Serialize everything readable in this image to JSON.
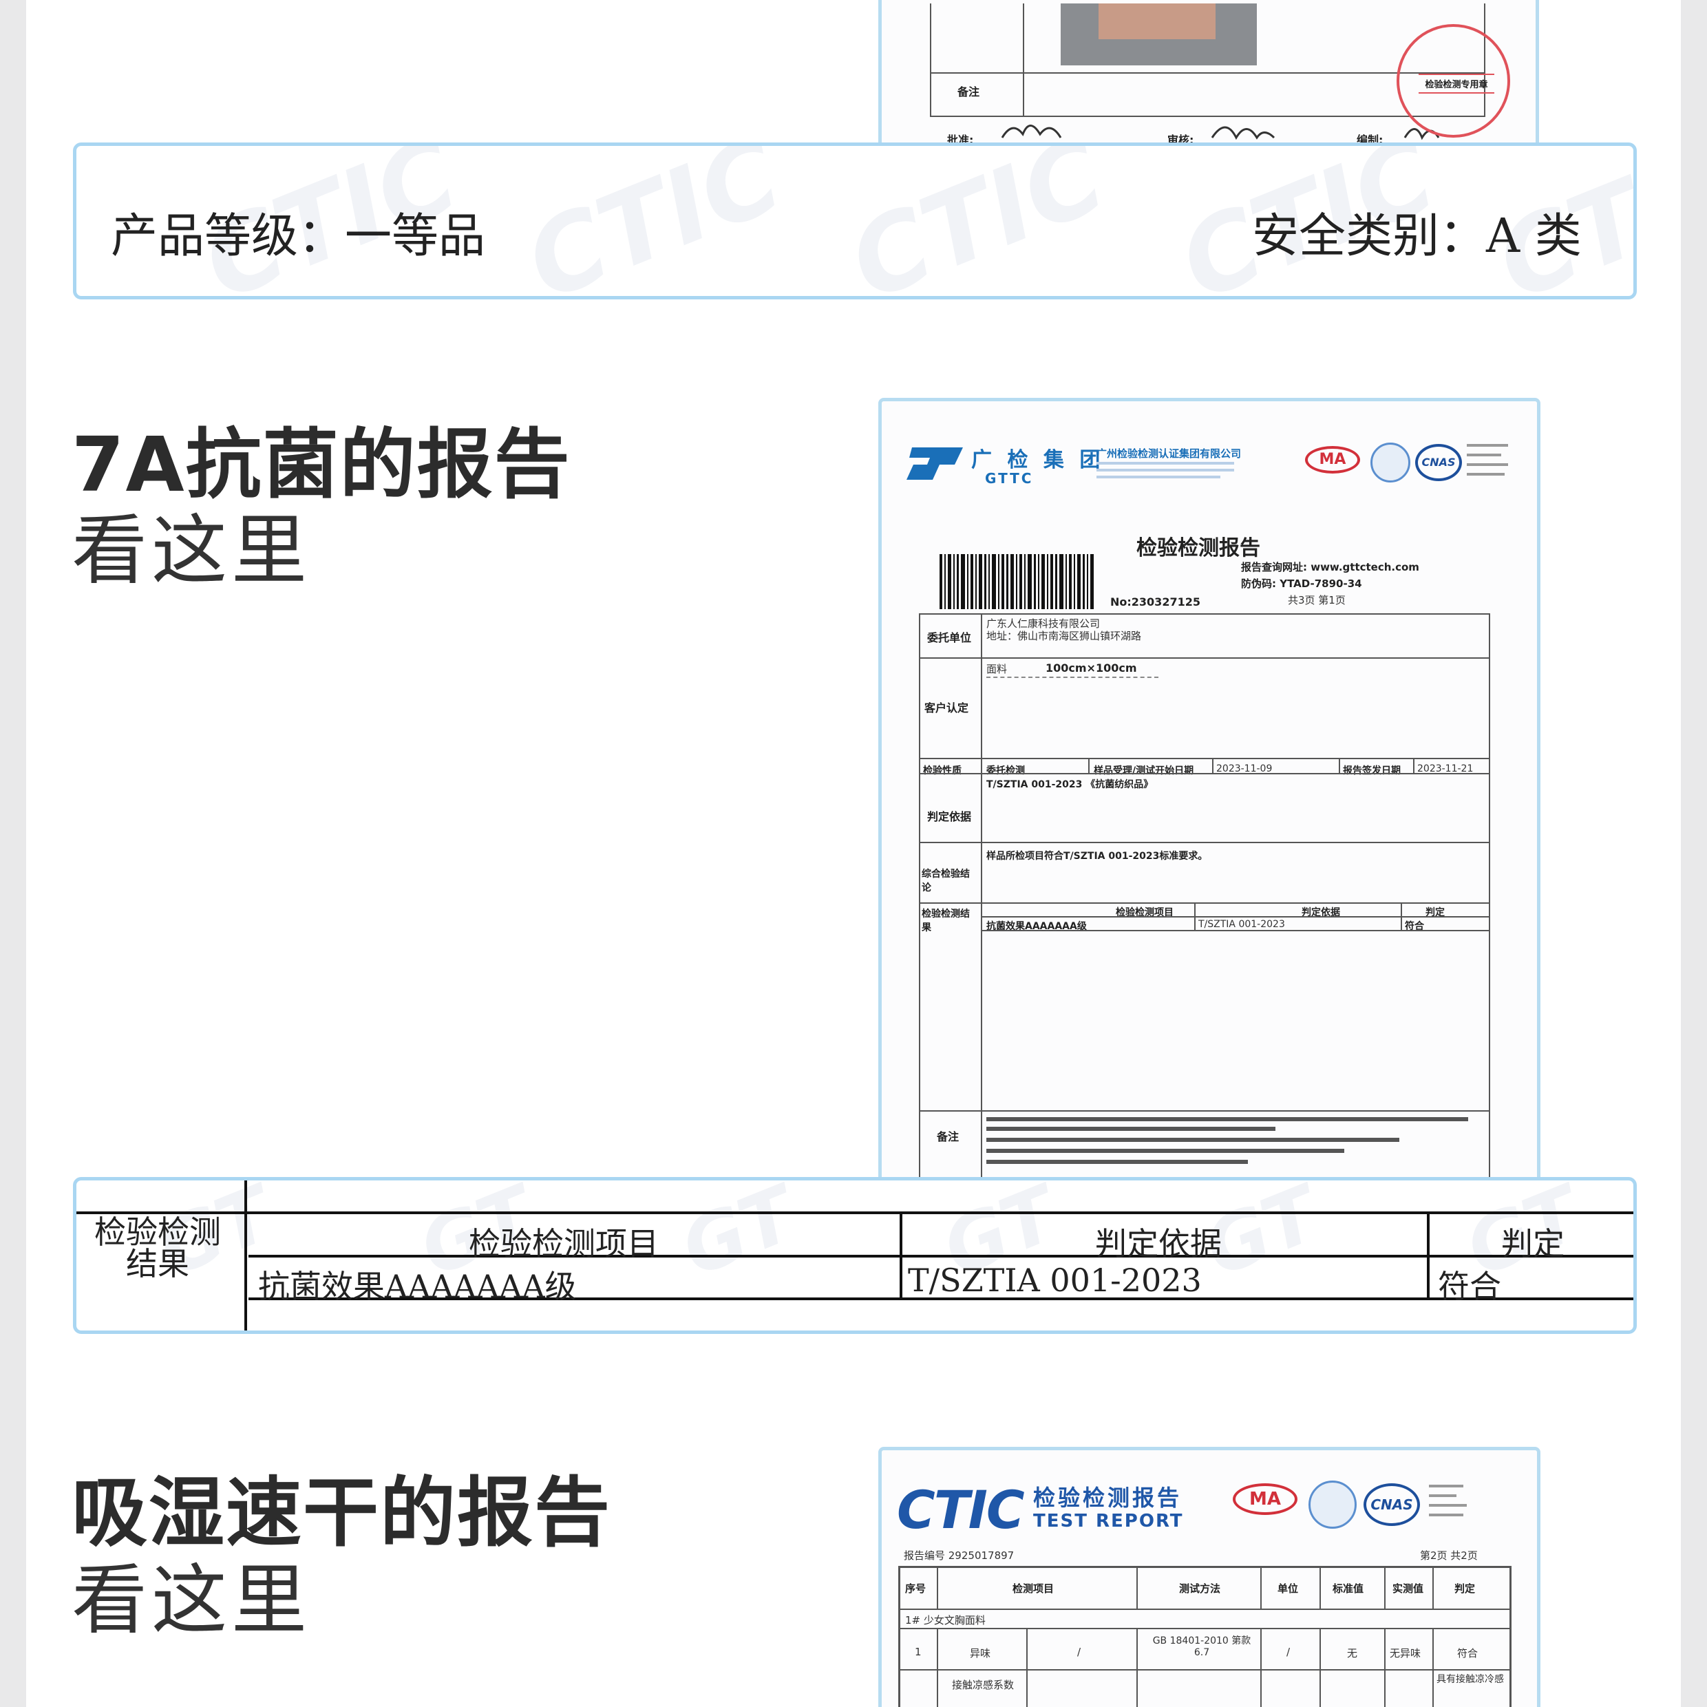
{
  "top_doc": {
    "remark_label": "备注",
    "bottom_labels": [
      "批准:",
      "审核:",
      "编制:"
    ],
    "stamp_text": "检验检测专用章"
  },
  "grade_panel": {
    "grade": "产品等级：一等品",
    "safety": "安全类别：A 类"
  },
  "section1": {
    "title": "7A抗菌的报告",
    "subtitle": "看这里"
  },
  "gttc_report": {
    "brand_cn": "广 检 集 团",
    "brand_en": "GTTC",
    "company": "广州检验检测认证集团有限公司",
    "title": "检验检测报告",
    "query_site": "报告查询网址: www.gttctech.com",
    "anti_fake": "防伪码: YTAD-7890-34",
    "page_info": "共3页 第1页",
    "report_no": "No:230327125",
    "client_label": "委托单位",
    "client_name": "广东人仁康科技有限公司",
    "client_addr": "地址：佛山市南海区狮山镇环湖路",
    "sample_label": "客户认定",
    "fabric": "面料",
    "size": "100cm×100cm",
    "nature_label": "检验性质",
    "nature_value": "委托检测",
    "receive_label": "样品受理/测试开始日期",
    "receive_date": "2023-11-09",
    "issue_label": "报告签发日期",
    "issue_date": "2023-11-21",
    "basis_label": "判定依据",
    "basis_value": "T/SZTIA 001-2023 《抗菌纺织品》",
    "conclusion_label": "综合检验结论",
    "conclusion_value": "样品所检项目符合T/SZTIA 001-2023标准要求。",
    "result_label": "检验检测结果",
    "item_head": "检验检测项目",
    "basis_head": "判定依据",
    "verdict_head": "判定",
    "item_value": "抗菌效果AAAAAAA级",
    "basis_short": "T/SZTIA 001-2023",
    "verdict_value": "符合",
    "remark_label": "备注"
  },
  "result_table": {
    "row_label": "检验检测结果",
    "head_item": "检验检测项目",
    "head_basis": "判定依据",
    "head_verdict": "判定",
    "cell_item": "抗菌效果AAAAAAA级",
    "cell_basis": "T/SZTIA 001-2023",
    "cell_verdict": "符合"
  },
  "section2": {
    "title": "吸湿速干的报告",
    "subtitle": "看这里"
  },
  "ctic_report": {
    "brand": "CTIC",
    "title_cn": "检验检测报告",
    "title_en": "TEST REPORT",
    "report_no": "报告编号 2925017897",
    "page_info": "第2页 共2页",
    "headers": [
      "序号",
      "检测项目",
      "测试方法",
      "单位",
      "标准值",
      "实测值",
      "判定"
    ],
    "group_row": "1# 少女文胸面料",
    "row1": [
      "1",
      "异味",
      "/",
      "GB 18401-2010 第款 6.7",
      "/",
      "无",
      "无异味",
      "符合"
    ],
    "row2_item": "接触凉感系数",
    "row2_note": "具有接触凉冷感"
  },
  "colors": {
    "panel_border": "#a9d6f2",
    "card_border": "#b7dcf1",
    "ma_red": "#d2303a",
    "cnas_blue": "#1d4f9c",
    "ctic_blue": "#1f57a8",
    "gttc_blue": "#1a6fb8"
  }
}
